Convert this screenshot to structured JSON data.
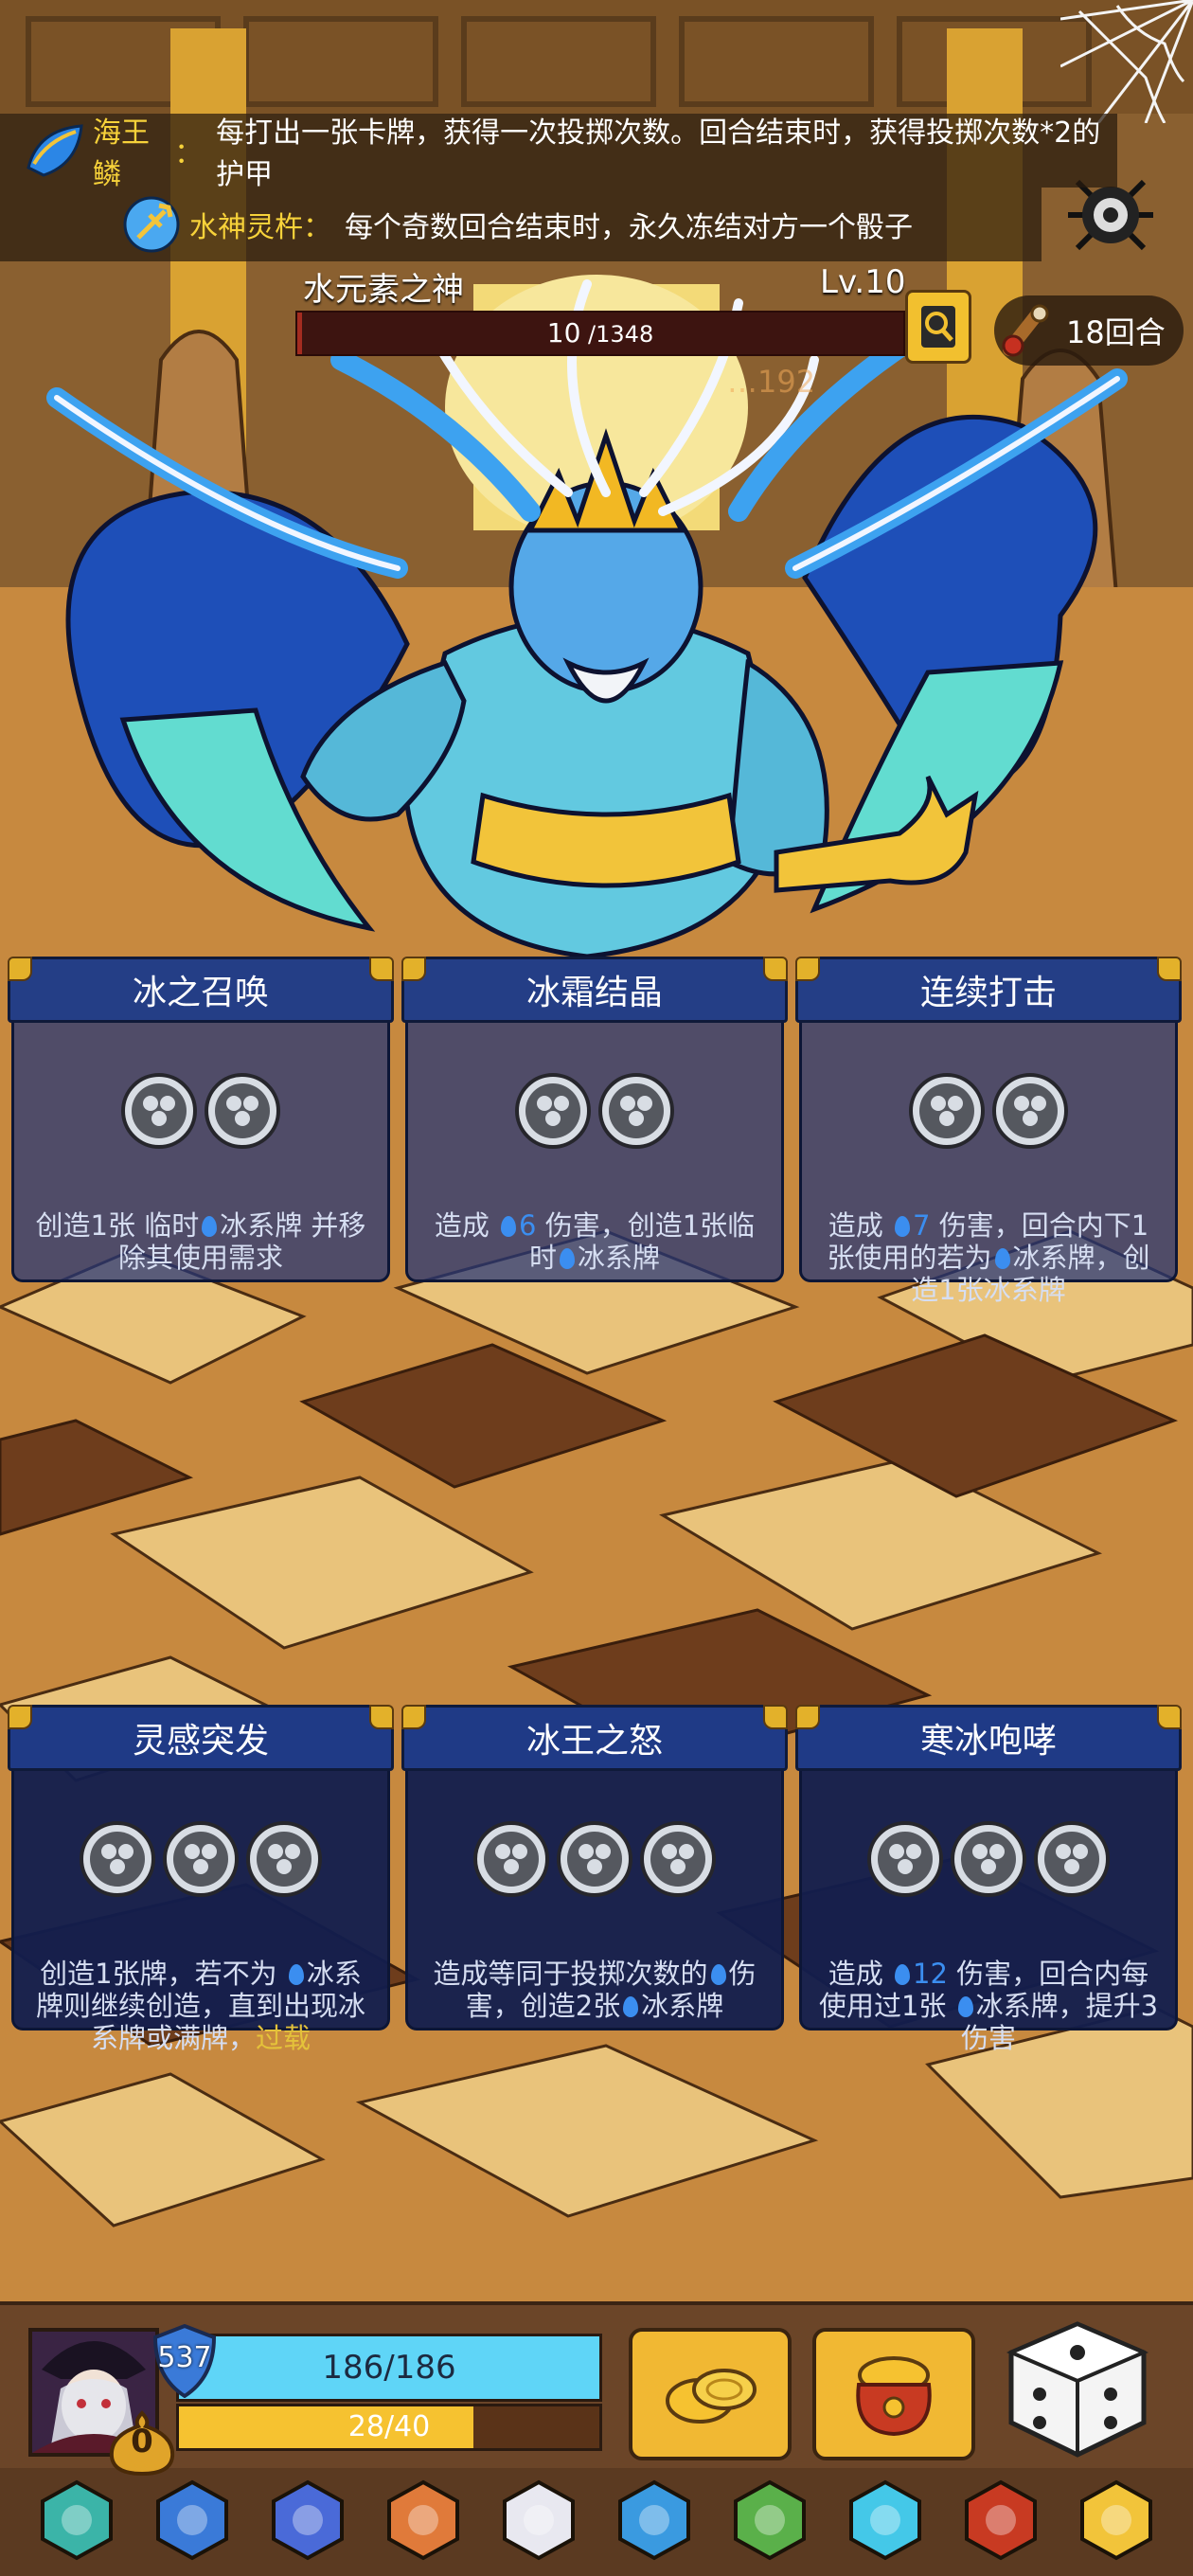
{
  "relics": [
    {
      "name": "海王鳞",
      "colon": "：",
      "description": "每打出一张卡牌，获得一次投掷次数。回合结束时，获得投掷次数*2的护甲",
      "icon": "scale-icon"
    },
    {
      "name": "水神灵杵",
      "colon": "：",
      "description": "每个奇数回合结束时，永久冻结对方一个骰子",
      "icon": "trident-icon"
    }
  ],
  "boss": {
    "name": "水元素之神",
    "level": "Lv.10",
    "hp_current": "10",
    "hp_max": " /1348",
    "hp_fraction": 0.0074,
    "faded_damage_text": "…192"
  },
  "round": {
    "label": "18回合",
    "icon": "scroll-icon"
  },
  "cards": [
    {
      "title": "冰之召唤",
      "slots": 2,
      "desc_parts": [
        "创造1张 临时",
        "drop",
        "冰系牌 并移除其使用需求"
      ],
      "style": "light"
    },
    {
      "title": "冰霜结晶",
      "slots": 2,
      "desc_parts": [
        "造成 ",
        "drop",
        "num:6",
        " 伤害，创造1张临时",
        "drop",
        "冰系牌"
      ],
      "style": "light"
    },
    {
      "title": "连续打击",
      "slots": 2,
      "desc_parts": [
        "造成 ",
        "drop",
        "num:7",
        " 伤害，回合内下1张使用的若为",
        "drop",
        "冰系牌，创造1张冰系牌"
      ],
      "style": "light"
    },
    {
      "title": "灵感突发",
      "slots": 3,
      "desc_parts": [
        "创造1张牌，若不为 ",
        "drop",
        "冰系牌则继续创造，直到出现冰系牌或满牌，",
        "kw:过载"
      ],
      "style": "dark"
    },
    {
      "title": "冰王之怒",
      "slots": 3,
      "desc_parts": [
        "造成等同于投掷次数的",
        "drop",
        "伤害，创造2张",
        "drop",
        "冰系牌"
      ],
      "style": "dark"
    },
    {
      "title": "寒冰咆哮",
      "slots": 3,
      "desc_parts": [
        "造成 ",
        "drop",
        "num:12",
        " 伤害，回合内每使用过1张 ",
        "drop",
        "冰系牌，提升3伤害"
      ],
      "style": "dark"
    }
  ],
  "player": {
    "armor": "537",
    "coins": "0",
    "hp_text": "186/186",
    "hp_fraction": 1.0,
    "energy_text": "28/40",
    "energy_fraction": 0.7
  },
  "relic_bar": [
    "lion-mask-icon",
    "ice-spike-icon",
    "jellyfish-icon",
    "meat-icon",
    "crystal-dice-icon",
    "shell-icon",
    "cactus-icon",
    "ice-shield-icon",
    "red-claw-icon",
    "golden-dice-icon"
  ],
  "colors": {
    "accent": "#f7d23a",
    "water": "#3b8ef0",
    "card_blue": "#243e86",
    "hp_blue": "#5fd5f7",
    "energy_yellow": "#f6c230",
    "boss_hp_red": "#a42c20"
  }
}
